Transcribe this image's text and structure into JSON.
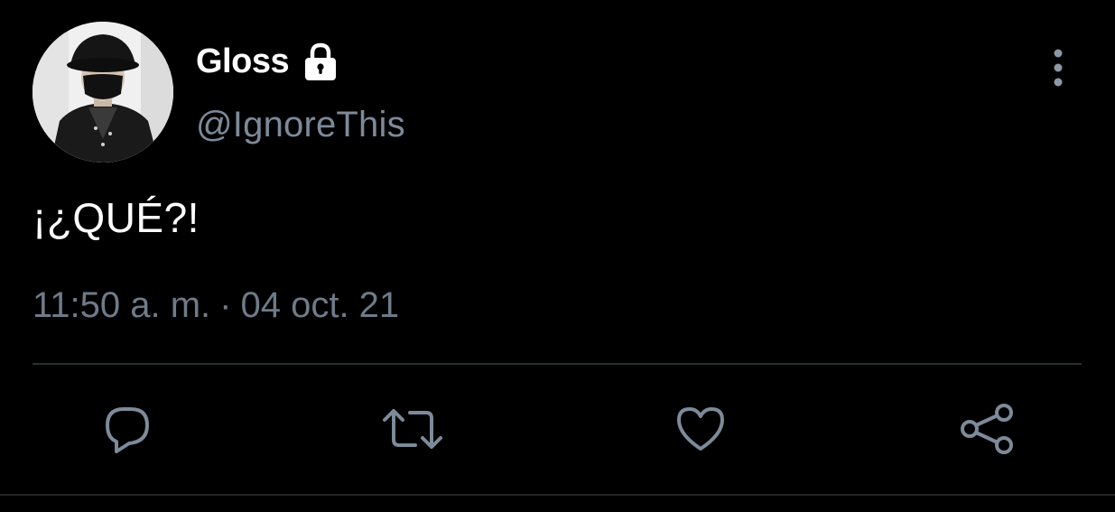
{
  "user": {
    "display_name": "Gloss",
    "handle": "@IgnoreThis",
    "protected_icon": "lock-icon",
    "avatar_icon": "user-avatar"
  },
  "tweet": {
    "text": "¡¿QUÉ?!",
    "time": "11:50 a. m.",
    "separator": "·",
    "date": "04 oct. 21"
  },
  "actions": [
    {
      "name": "reply",
      "icon": "reply-icon"
    },
    {
      "name": "retweet",
      "icon": "retweet-icon"
    },
    {
      "name": "like",
      "icon": "like-icon"
    },
    {
      "name": "share",
      "icon": "share-icon"
    }
  ],
  "colors": {
    "background": "#000000",
    "primary_text": "#ffffff",
    "secondary_text": "#7c8a99",
    "icon": "#7c8a99",
    "divider": "#2a2f33"
  }
}
